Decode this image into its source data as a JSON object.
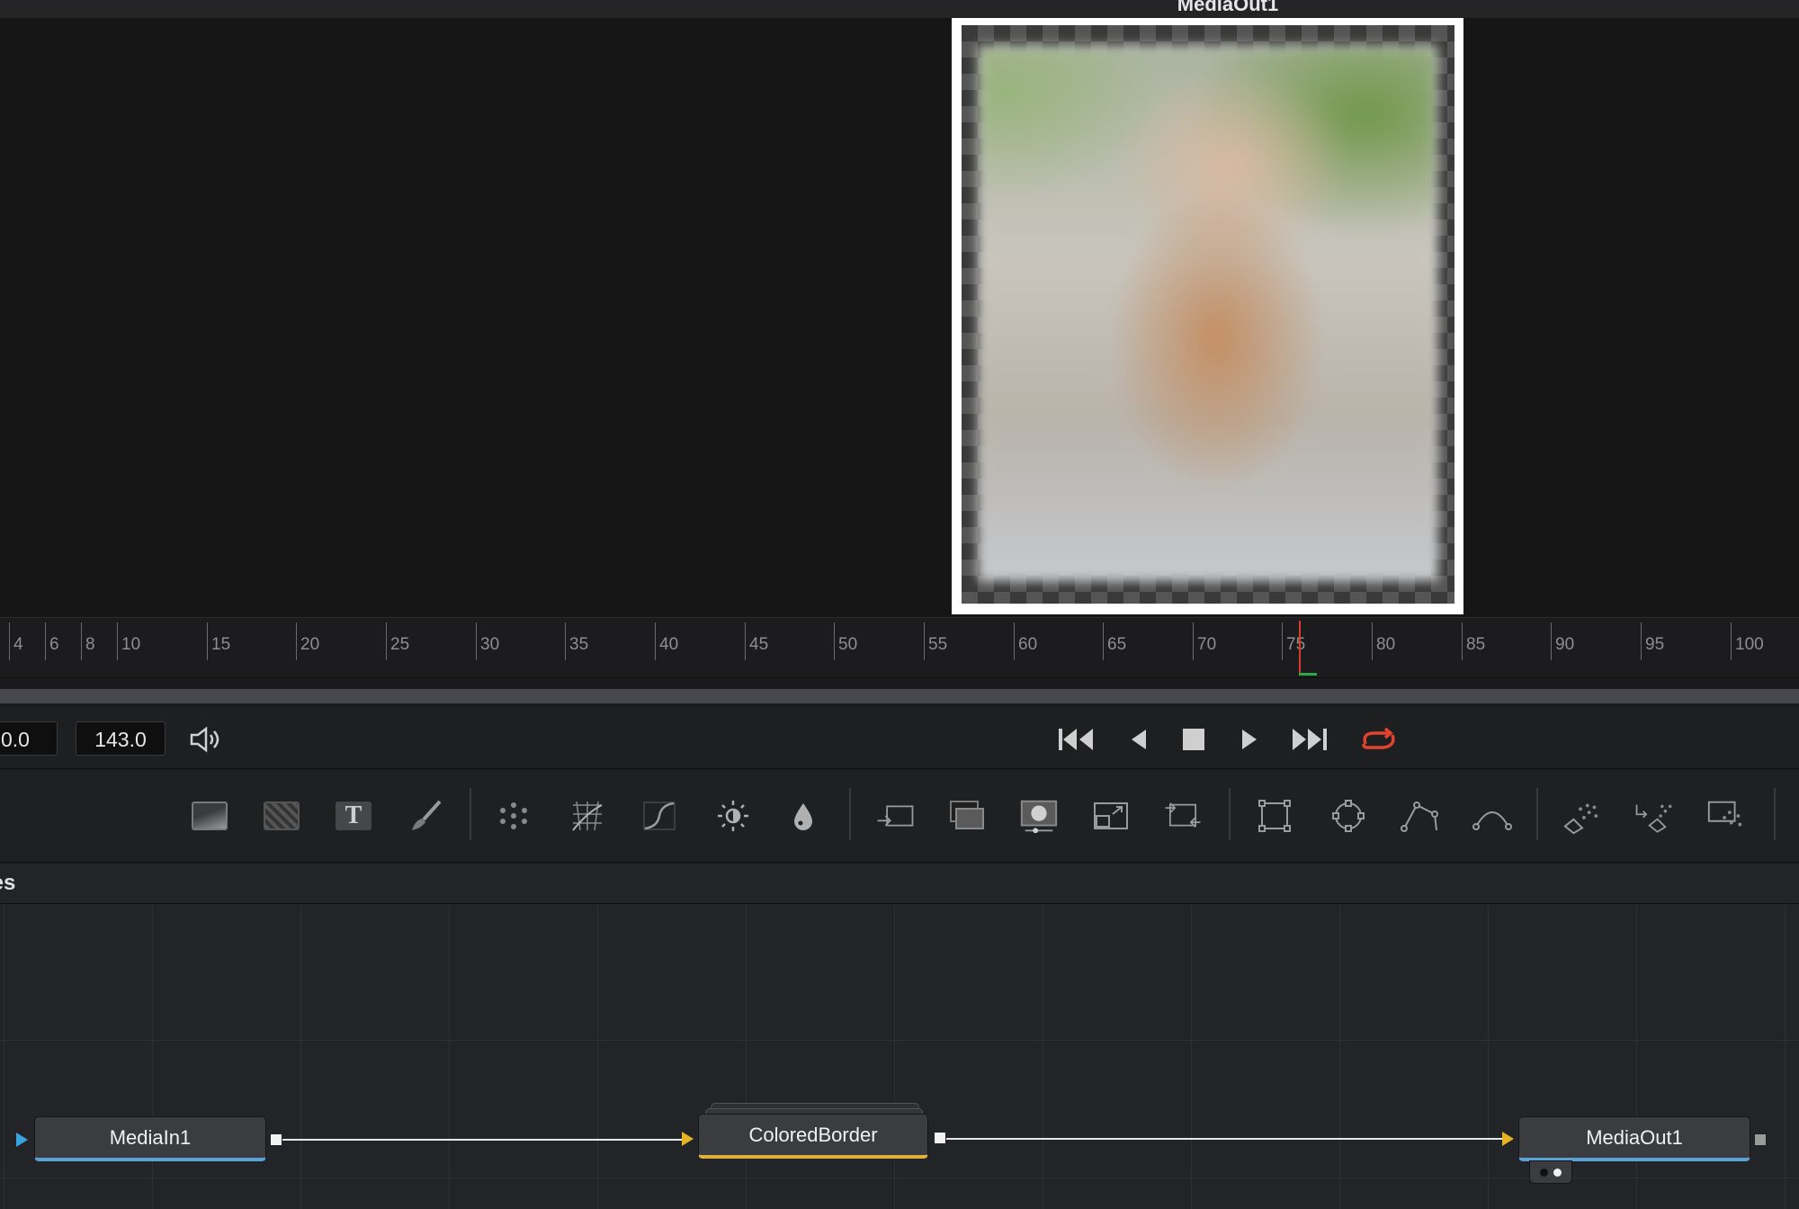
{
  "viewer": {
    "title": "MediaOut1"
  },
  "ruler": {
    "ticks": [
      "4",
      "6",
      "8",
      "10",
      "15",
      "20",
      "25",
      "30",
      "35",
      "40",
      "45",
      "50",
      "55",
      "60",
      "65",
      "70",
      "75",
      "80",
      "85",
      "90",
      "95",
      "100"
    ]
  },
  "transport": {
    "start_frame": "0.0",
    "end_frame": "143.0",
    "audio_icon": "speaker-icon",
    "buttons": [
      "go-to-start",
      "step-back",
      "stop",
      "play",
      "go-to-end",
      "loop"
    ],
    "loop_color": "#e0442f"
  },
  "toolbar": {
    "icons": [
      "background-icon",
      "fast-noise-icon",
      "text-icon",
      "paint-icon",
      "particles-icon",
      "grid-warp-icon",
      "color-curves-icon",
      "brightness-contrast-icon",
      "blur-icon",
      "merge-icon",
      "channel-boolean-icon",
      "matte-control-icon",
      "resize-icon",
      "transform-icon",
      "rectangle-mask-icon",
      "ellipse-mask-icon",
      "polygon-mask-icon",
      "bspline-mask-icon",
      "p-emitter-icon",
      "p-render-icon",
      "image-plane-icon"
    ]
  },
  "nodes_panel": {
    "title": "Nodes"
  },
  "nodes": {
    "media_in": "MediaIn1",
    "colored_border": "ColoredBorder",
    "media_out": "MediaOut1"
  }
}
